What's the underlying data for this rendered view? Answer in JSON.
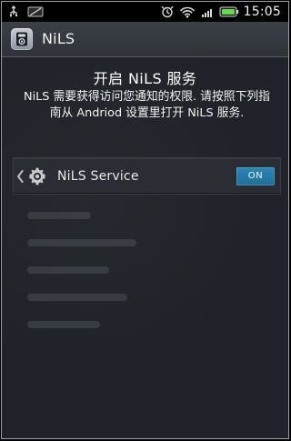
{
  "status_bar": {
    "time": "15:05",
    "battery_text": "",
    "icons": [
      "usb-icon",
      "no-signal-icon",
      "alarm-icon",
      "wifi-icon",
      "signal-icon",
      "battery-icon"
    ]
  },
  "app_bar": {
    "title": "NiLS",
    "icon": "nils-app-icon"
  },
  "intro": {
    "title": "开启 NiLS 服务",
    "text": "NiLS 需要获得访问您通知的权限. 请按照下列指南从 Andriod 设置里打开 NiLS 服务."
  },
  "setting": {
    "label": "NiLS Service",
    "icon": "gear-icon",
    "toggle_text": "ON",
    "toggle_state": "on",
    "accent": "#2d86b2"
  }
}
